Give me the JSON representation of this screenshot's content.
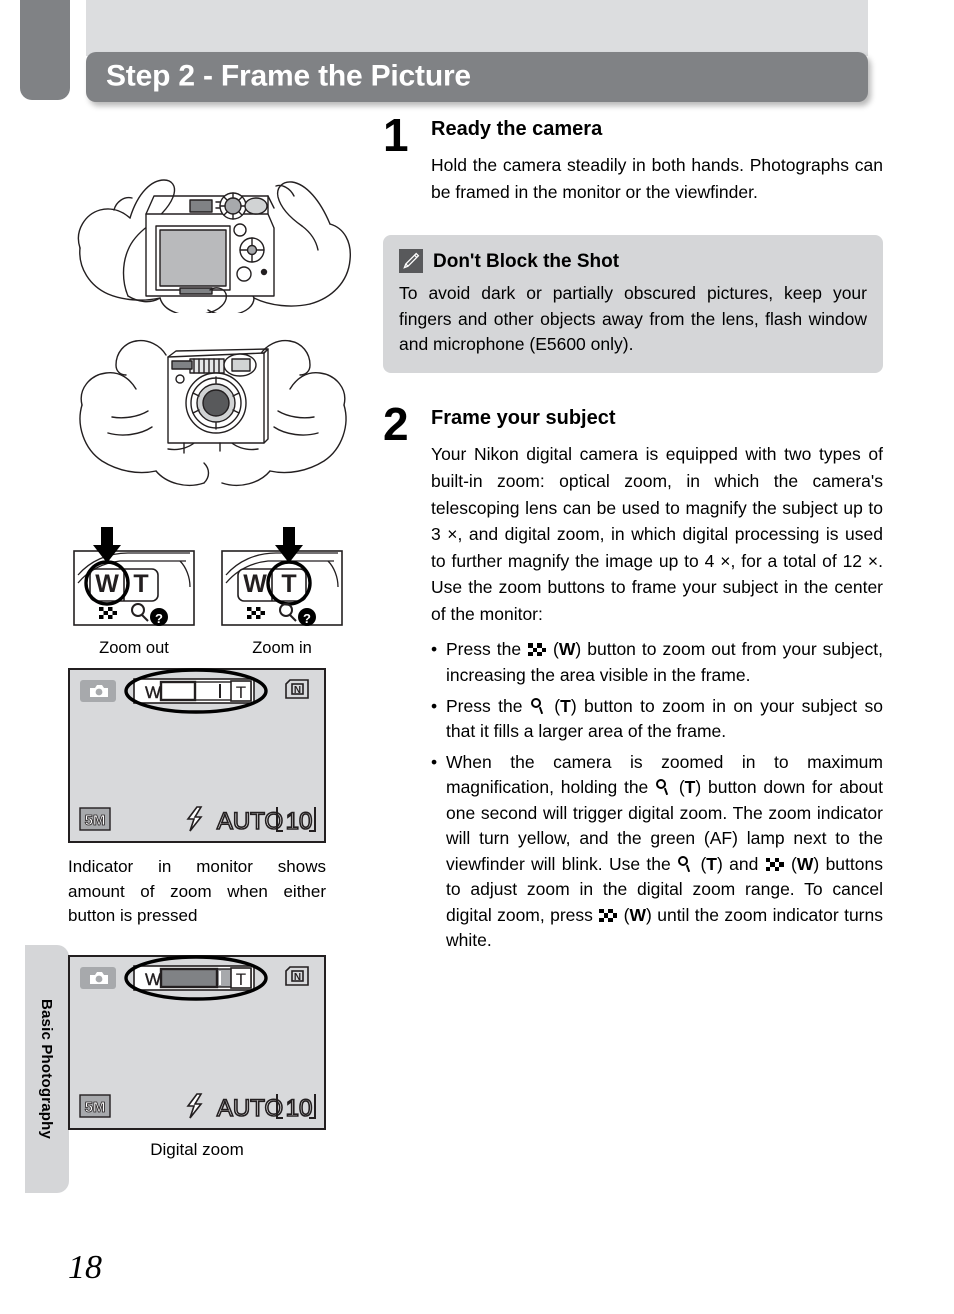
{
  "page": {
    "number": "18",
    "side_tab_label": "Basic Photography",
    "header_title": "Step 2 - Frame the Picture"
  },
  "steps": [
    {
      "number": "1",
      "title": "Ready the camera",
      "text": "Hold the camera steadily in both hands. Photographs can be framed in the monitor or the viewfinder."
    },
    {
      "number": "2",
      "title": "Frame your subject",
      "text": "Your Nikon digital camera is equipped with two types of built-in zoom: optical zoom, in which the camera's telescoping lens can be used to magnify the subject up to 3 ×, and digital zoom, in which digital processing is used to further magnify the image up to 4 ×, for a total of 12 ×. Use the zoom buttons to frame your subject in the center of the monitor:"
    }
  ],
  "tip": {
    "icon": "pencil-icon",
    "title": "Don't Block the Shot",
    "text": "To avoid dark or partially obscured pictures, keep your fingers and other objects away from the lens, flash window and microphone (E5600 only)."
  },
  "bullets": [
    {
      "segments": [
        {
          "type": "text",
          "value": "Press the "
        },
        {
          "type": "icon",
          "value": "wide-zoom-icon"
        },
        {
          "type": "text",
          "value": " ("
        },
        {
          "type": "bold",
          "value": "W"
        },
        {
          "type": "text",
          "value": ") button to zoom out from your subject, increasing the area visible in the frame."
        }
      ]
    },
    {
      "segments": [
        {
          "type": "text",
          "value": "Press the "
        },
        {
          "type": "icon",
          "value": "tele-zoom-icon"
        },
        {
          "type": "text",
          "value": " ("
        },
        {
          "type": "bold",
          "value": "T"
        },
        {
          "type": "text",
          "value": ") button to zoom in on your subject so that it fills a larger area of the frame."
        }
      ]
    },
    {
      "segments": [
        {
          "type": "text",
          "value": "When the camera is zoomed in to maximum magnification, holding the "
        },
        {
          "type": "icon",
          "value": "tele-zoom-icon"
        },
        {
          "type": "text",
          "value": " ("
        },
        {
          "type": "bold",
          "value": "T"
        },
        {
          "type": "text",
          "value": ") button down for about one second will trigger digital zoom. The zoom indicator will turn yellow, and the green (AF) lamp next to the viewfinder will blink. Use the "
        },
        {
          "type": "icon",
          "value": "tele-zoom-icon"
        },
        {
          "type": "text",
          "value": " ("
        },
        {
          "type": "bold",
          "value": "T"
        },
        {
          "type": "text",
          "value": ") and "
        },
        {
          "type": "icon",
          "value": "wide-zoom-icon"
        },
        {
          "type": "text",
          "value": " ("
        },
        {
          "type": "bold",
          "value": "W"
        },
        {
          "type": "text",
          "value": ") buttons to adjust zoom in the digital zoom range. To cancel digital zoom, press "
        },
        {
          "type": "icon",
          "value": "wide-zoom-icon"
        },
        {
          "type": "text",
          "value": " ("
        },
        {
          "type": "bold",
          "value": "W"
        },
        {
          "type": "text",
          "value": ") until the zoom indicator turns white."
        }
      ]
    }
  ],
  "figures": {
    "camera_back": {
      "alt": "camera-held-in-two-hands-rear-view"
    },
    "camera_front": {
      "alt": "camera-held-in-two-hands-front-view"
    },
    "zoom_out": {
      "caption": "Zoom out",
      "button_w": "W",
      "button_t": "T"
    },
    "zoom_in": {
      "caption": "Zoom in",
      "button_w": "W",
      "button_t": "T"
    },
    "monitor_optical": {
      "indicator_w": "W",
      "indicator_t": "T",
      "image_size": "5M",
      "flash_mode": "AUTO",
      "frames_remaining": "10",
      "caption": "Indicator in monitor shows amount of zoom when either button is pressed"
    },
    "monitor_digital": {
      "indicator_w": "W",
      "indicator_t": "T",
      "image_size": "5M",
      "flash_mode": "AUTO",
      "frames_remaining": "10",
      "caption": "Digital zoom"
    }
  },
  "colors": {
    "header_gray": "#808285",
    "band_gray": "#dcdddf",
    "tip_gray": "#d5d6d8",
    "monitor_gray": "#d8d9db"
  }
}
